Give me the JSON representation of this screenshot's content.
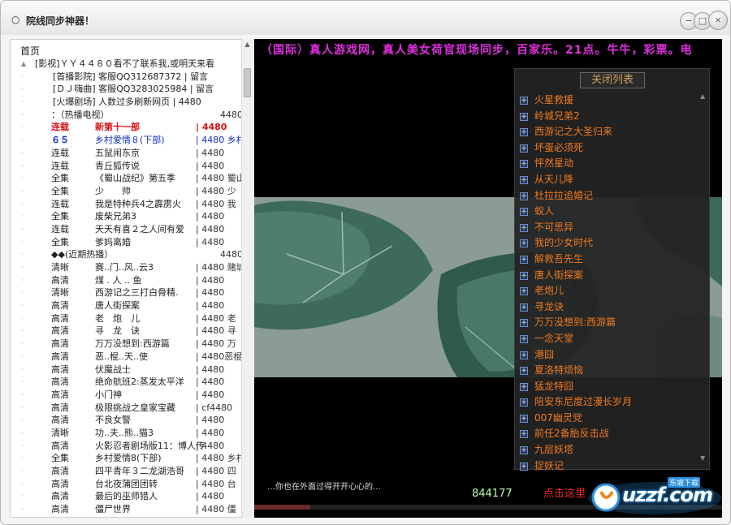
{
  "window": {
    "title": "院线同步神器！",
    "icon": "app-chat-icon",
    "buttons": {
      "min": "−",
      "max": "□",
      "close": "×"
    }
  },
  "tree": {
    "root_label": "首页",
    "rows": [
      {
        "kind": "line",
        "text": "[影视]ＹＹ４４８０看不了联系我,或明天来看"
      },
      {
        "kind": "line",
        "text": "　　[首播影院] 客服QQ312687372 | 留言"
      },
      {
        "kind": "line",
        "text": "　　[ＤＪ嗨曲] 客服QQ3283025984 | 留言"
      },
      {
        "kind": "line",
        "text": "　　[火爆剧场] 人数过多刷新网页 | 4480"
      },
      {
        "kind": "hdr",
        "text": "：（热播电视）",
        "tail": "4480"
      },
      {
        "kind": "red",
        "qual": "连载",
        "title": "新第十一部",
        "tail": "| 4480"
      },
      {
        "kind": "blue",
        "qual": "６５",
        "title": "乡村爱情８(下部)",
        "tail": "| 4480 乡村"
      },
      {
        "qual": "连载",
        "title": "五鼠闹东京",
        "tail": "| 4480"
      },
      {
        "qual": "连载",
        "title": "青丘狐传说",
        "tail": "| 4480"
      },
      {
        "qual": "全集",
        "title": "《蜀山战纪》第五季",
        "tail": "| 4480 蜀山"
      },
      {
        "qual": "全集",
        "title": "少　　帅",
        "tail": "| 4480 少"
      },
      {
        "qual": "连载",
        "title": "我是特种兵4之霹雳火",
        "tail": "| 4480 我"
      },
      {
        "qual": "全集",
        "title": "废柴兄弟3",
        "tail": "| 4480"
      },
      {
        "qual": "连载",
        "title": "天天有喜２之人间有爱",
        "tail": "| 4480"
      },
      {
        "qual": "全集",
        "title": "爹妈离婚",
        "tail": "| 4480"
      },
      {
        "kind": "hdr",
        "text": "◆◆(近期热播）",
        "tail": "4480"
      },
      {
        "qual": "清晰",
        "title": "赛..门..风..云3",
        "tail": "| 4480 赌城风"
      },
      {
        "qual": "高清",
        "title": "煤 . 人 .. 鱼",
        "tail": "| 4480"
      },
      {
        "qual": "清晰",
        "title": "西游记之三打白骨精.",
        "tail": "| 4480"
      },
      {
        "qual": "高清",
        "title": "唐人街探案",
        "tail": "| 4480"
      },
      {
        "qual": "高清",
        "title": "老　炮　儿",
        "tail": "| 4480 老"
      },
      {
        "qual": "高清",
        "title": "寻　龙　诀",
        "tail": "| 4480 寻"
      },
      {
        "qual": "高清",
        "title": "万万没想到:西游篇",
        "tail": "| 4480 万"
      },
      {
        "qual": "高清",
        "title": "恶..棍..天..使",
        "tail": "| 4480恶棍天使"
      },
      {
        "qual": "高清",
        "title": "伏魔战士",
        "tail": "| 4480"
      },
      {
        "qual": "高清",
        "title": "绝命航班2:蒸发太平洋",
        "tail": "| 4480"
      },
      {
        "qual": "高清",
        "title": "小门神",
        "tail": "| 4480"
      },
      {
        "qual": "高清",
        "title": "极限挑战之皇家宝藏",
        "tail": "| cf4480"
      },
      {
        "qual": "高清",
        "title": "不良女警",
        "tail": "| 4480"
      },
      {
        "qual": "清晰",
        "title": "功..夫..熊..猫3",
        "tail": "| 4480"
      },
      {
        "qual": "高清",
        "title": "火影忍者剧场版11：博人传",
        "tail": "| 4480"
      },
      {
        "qual": "全集",
        "title": "乡村爱情8(下部)",
        "tail": "| 4480 乡村"
      },
      {
        "qual": "高清",
        "title": "四平青年３二龙湖浩哥",
        "tail": "| 4480 四"
      },
      {
        "qual": "高清",
        "title": "台北夜蒲团团转",
        "tail": "| 4480 台"
      },
      {
        "qual": "高清",
        "title": "最后的巫师猎人",
        "tail": "| 4480"
      },
      {
        "qual": "高清",
        "title": "僵尸世界",
        "tail": "| 4480 僵"
      }
    ]
  },
  "player": {
    "marquee": "（国际）真人游戏网，真人美女荷官现场同步，百家乐。21点。牛牛，彩票。电",
    "subtitle": "…你也在外面过得开开心心的…",
    "counter": "844177",
    "click_here": "点击这里",
    "progress": 0.12
  },
  "list_panel": {
    "header": "关闭列表",
    "items": [
      "火星救援",
      "岭城兄弟2",
      "西游记之大圣归来",
      "坏蛋必须死",
      "怦然星动",
      "从天儿降",
      "杜拉拉追婚记",
      "蚁人",
      "不可思异",
      "我的少女时代",
      "解救吾先生",
      "唐人街探案",
      "老炮儿",
      "寻龙诀",
      "万万没想到:西游篇",
      "一念天堂",
      "港囧",
      "夏洛特烦恼",
      "猛龙特囧",
      "陪安东尼度过漫长岁月",
      "007幽灵党",
      "前任2备胎反击战",
      "九层妖塔",
      "捉妖记"
    ]
  },
  "logo": {
    "text": "uzzf.com",
    "cn": "东坡下载"
  },
  "colors": {
    "marquee": "#e030e0",
    "list_text": "#f07a20",
    "red_row": "#d81010",
    "blue_row": "#1030c0"
  }
}
